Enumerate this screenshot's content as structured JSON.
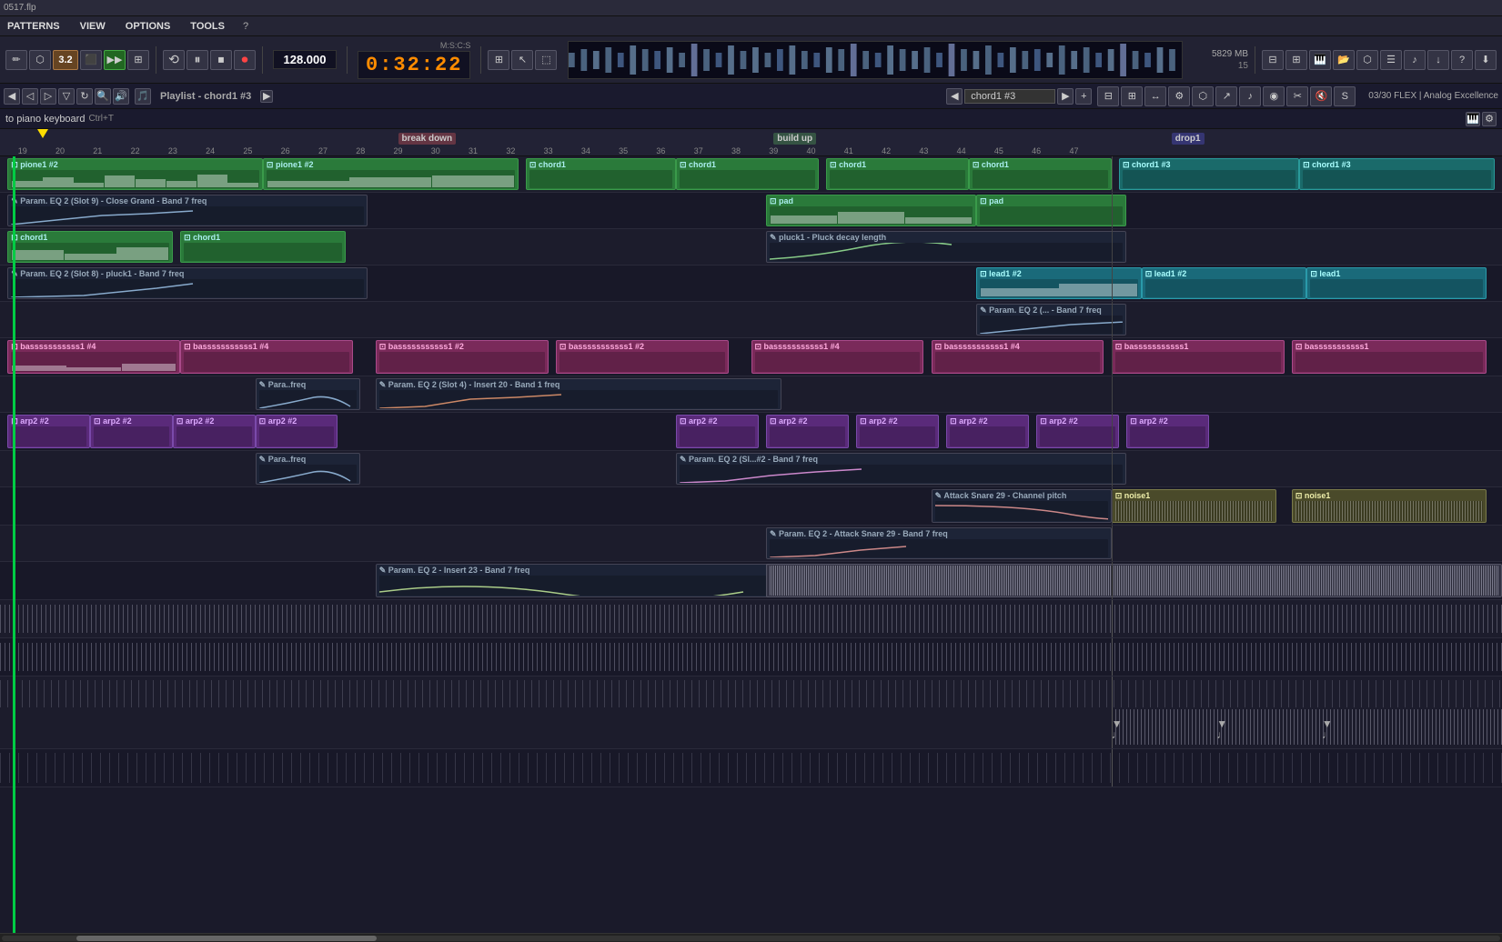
{
  "titlebar": {
    "filename": "0517.flp"
  },
  "menubar": {
    "items": [
      "PATTERNS",
      "VIEW",
      "OPTIONS",
      "TOOLS",
      "?"
    ]
  },
  "transport": {
    "bpm": "128.000",
    "time": "0:32:22",
    "mscs": "M:S:C:S",
    "pattern_num": "3",
    "pattern_label": "3.2",
    "mem": "5829 MB",
    "row2": "15",
    "buttons": {
      "rewind": "⏮",
      "play_pause": "⏸",
      "stop": "⏹",
      "record": "⏺"
    }
  },
  "channel": {
    "name": "chord1 #3",
    "mixer_info": "03/30  FLEX  |  Analog Excellence"
  },
  "instrument": {
    "label": "to piano keyboard",
    "shortcut": "Ctrl+T"
  },
  "playlist": {
    "title": "Playlist - chord1 #3"
  },
  "timeline": {
    "markers": [
      19,
      20,
      21,
      22,
      23,
      24,
      25,
      26,
      27,
      28,
      29,
      30,
      31,
      32,
      33,
      34,
      35,
      36,
      37,
      38,
      39,
      40,
      41,
      42,
      43,
      44,
      45,
      46,
      47
    ],
    "sections": [
      {
        "label": "break down",
        "pos": 25,
        "type": "break"
      },
      {
        "label": "build up",
        "pos": 33,
        "type": "build"
      },
      {
        "label": "drop1",
        "pos": 41,
        "type": "drop"
      }
    ]
  },
  "tracks": [
    {
      "id": "piano1",
      "clips": [
        {
          "label": "pione1 #2",
          "color": "green",
          "start_pct": 0,
          "width_pct": 17
        },
        {
          "label": "pione1 #2",
          "color": "green",
          "start_pct": 17,
          "width_pct": 17
        },
        {
          "label": "chord1",
          "color": "green",
          "start_pct": 34.5,
          "width_pct": 12.5
        },
        {
          "label": "chord1",
          "color": "green",
          "start_pct": 47,
          "width_pct": 10
        },
        {
          "label": "chord1",
          "color": "green",
          "start_pct": 57,
          "width_pct": 10
        },
        {
          "label": "chord1",
          "color": "green",
          "start_pct": 67,
          "width_pct": 10
        },
        {
          "label": "chord1 #3",
          "color": "teal",
          "start_pct": 78,
          "width_pct": 11
        },
        {
          "label": "chord1 #3",
          "color": "teal",
          "start_pct": 89,
          "width_pct": 11
        }
      ]
    },
    {
      "id": "eq9",
      "clips": [
        {
          "label": "Param. EQ 2 (Slot 9) - Close Grand - Band 7 freq",
          "color": "automation",
          "start_pct": 0,
          "width_pct": 25
        },
        {
          "label": "pad",
          "color": "green",
          "start_pct": 51.5,
          "width_pct": 15
        },
        {
          "label": "pad",
          "color": "green",
          "start_pct": 66.5,
          "width_pct": 10
        }
      ]
    },
    {
      "id": "chord1",
      "clips": [
        {
          "label": "chord1",
          "color": "green",
          "start_pct": 0,
          "width_pct": 10
        },
        {
          "label": "chord1",
          "color": "green",
          "start_pct": 10,
          "width_pct": 10
        },
        {
          "label": "pluck1 - Pluck decay length",
          "color": "automation",
          "start_pct": 51.5,
          "width_pct": 25
        }
      ]
    },
    {
      "id": "eq8",
      "clips": [
        {
          "label": "Param. EQ 2 (Slot 8) - pluck1 - Band 7 freq",
          "color": "automation",
          "start_pct": 0,
          "width_pct": 25
        },
        {
          "label": "lead1 #2",
          "color": "cyan",
          "start_pct": 66,
          "width_pct": 12
        },
        {
          "label": "lead1 #2",
          "color": "cyan",
          "start_pct": 78,
          "width_pct": 11
        },
        {
          "label": "lead1",
          "color": "cyan",
          "start_pct": 89,
          "width_pct": 11
        }
      ]
    },
    {
      "id": "eq_lead",
      "clips": [
        {
          "label": "Param. EQ 2 (... - Band 7 freq",
          "color": "automation",
          "start_pct": 66,
          "width_pct": 11
        }
      ]
    },
    {
      "id": "bass",
      "clips": [
        {
          "label": "basssssssssss1 #4",
          "color": "pink",
          "start_pct": 0,
          "width_pct": 12
        },
        {
          "label": "basssssssssss1 #4",
          "color": "pink",
          "start_pct": 12,
          "width_pct": 12
        },
        {
          "label": "basssssssssss1 #2",
          "color": "pink",
          "start_pct": 26,
          "width_pct": 12
        },
        {
          "label": "basssssssssss1 #2",
          "color": "pink",
          "start_pct": 38,
          "width_pct": 12
        },
        {
          "label": "basssssssssss1 #4",
          "color": "pink",
          "start_pct": 51,
          "width_pct": 12
        },
        {
          "label": "basssssssssss1 #4",
          "color": "pink",
          "start_pct": 63,
          "width_pct": 12
        },
        {
          "label": "basssssssssss1",
          "color": "pink",
          "start_pct": 77,
          "width_pct": 11
        },
        {
          "label": "basssssssssss1",
          "color": "pink",
          "start_pct": 88,
          "width_pct": 12
        }
      ]
    },
    {
      "id": "eq_bass",
      "clips": [
        {
          "label": "Para..freq",
          "color": "automation",
          "start_pct": 17,
          "width_pct": 7
        },
        {
          "label": "Param. EQ 2 (Slot 4) - Insert 20 - Band 1 freq",
          "color": "automation",
          "start_pct": 25.5,
          "width_pct": 27
        }
      ]
    },
    {
      "id": "arp2",
      "clips": [
        {
          "label": "arp2 #2",
          "color": "purple",
          "start_pct": 0,
          "width_pct": 6
        },
        {
          "label": "arp2 #2",
          "color": "purple",
          "start_pct": 6,
          "width_pct": 6
        },
        {
          "label": "arp2 #2",
          "color": "purple",
          "start_pct": 12,
          "width_pct": 6
        },
        {
          "label": "arp2 #2",
          "color": "purple",
          "start_pct": 18,
          "width_pct": 6
        },
        {
          "label": "arp2 #2",
          "color": "purple",
          "start_pct": 46,
          "width_pct": 6
        },
        {
          "label": "arp2 #2",
          "color": "purple",
          "start_pct": 52,
          "width_pct": 6
        },
        {
          "label": "arp2 #2",
          "color": "purple",
          "start_pct": 58,
          "width_pct": 6
        },
        {
          "label": "arp2 #2",
          "color": "purple",
          "start_pct": 64,
          "width_pct": 6
        },
        {
          "label": "arp2 #2",
          "color": "purple",
          "start_pct": 70,
          "width_pct": 6
        },
        {
          "label": "arp2 #2",
          "color": "purple",
          "start_pct": 76,
          "width_pct": 6
        }
      ]
    },
    {
      "id": "eq_arp",
      "clips": [
        {
          "label": "Para..freq",
          "color": "automation",
          "start_pct": 17,
          "width_pct": 7
        },
        {
          "label": "Param. EQ 2 (Sl...#2 - Band 7 freq",
          "color": "automation",
          "start_pct": 46,
          "width_pct": 30
        }
      ]
    },
    {
      "id": "attack_snare",
      "clips": [
        {
          "label": "Attack Snare 29 - Channel pitch",
          "color": "automation",
          "start_pct": 63,
          "width_pct": 14
        },
        {
          "label": "noise1",
          "color": "noise",
          "start_pct": 78,
          "width_pct": 11
        },
        {
          "label": "noise1",
          "color": "noise",
          "start_pct": 89,
          "width_pct": 11
        }
      ]
    },
    {
      "id": "eq_snare",
      "clips": [
        {
          "label": "Param. EQ 2 - Attack Snare 29 - Band 7 freq",
          "color": "automation",
          "start_pct": 51,
          "width_pct": 26
        }
      ]
    },
    {
      "id": "eq_insert23",
      "clips": [
        {
          "label": "Param. EQ 2 - Insert 23 - Band 7 freq",
          "color": "automation",
          "start_pct": 25.5,
          "width_pct": 51
        }
      ]
    },
    {
      "id": "drums1",
      "clips": []
    },
    {
      "id": "drums2",
      "clips": []
    }
  ],
  "toolbar_right": {
    "buttons": [
      "mixer",
      "channel-rack",
      "piano-roll",
      "browser",
      "plugins",
      "step-seq",
      "fx",
      "midi",
      "export",
      "help"
    ]
  },
  "colors": {
    "green_clip": "#2a7a3a",
    "teal_clip": "#1a6a6a",
    "purple_clip": "#5a2a7a",
    "pink_clip": "#7a2a5a",
    "cyan_clip": "#1a6a7a",
    "noise_clip": "#5a5a2a",
    "automation_clip": "#1e2840",
    "bg_dark": "#1a1a2a",
    "timeline_bg": "#222235",
    "accent_yellow": "#ffdd00",
    "accent_orange": "#ff8c00"
  }
}
